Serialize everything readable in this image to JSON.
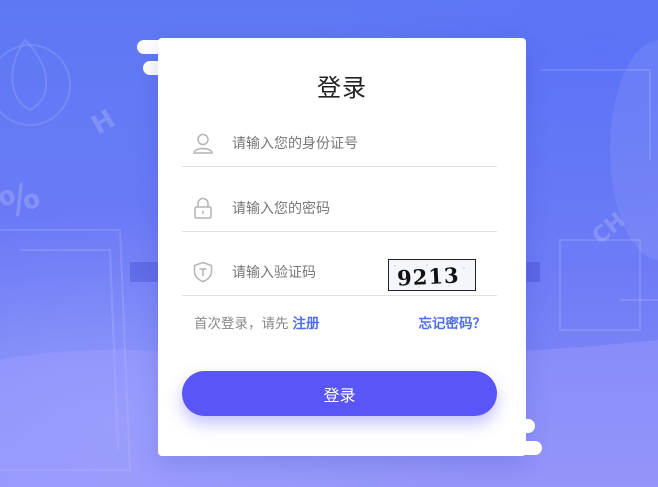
{
  "login_card": {
    "title": "登录",
    "id_field": {
      "placeholder": "请输入您的身份证号",
      "value": ""
    },
    "password_field": {
      "placeholder": "请输入您的密码",
      "value": ""
    },
    "captcha_field": {
      "placeholder": "请输入验证码",
      "value": ""
    },
    "captcha_image_text": "9213",
    "first_login_text": "首次登录，请先",
    "register_link": "注册",
    "forgot_password_link": "忘记密码？",
    "login_button": "登录"
  },
  "colors": {
    "background": "#6f7cf7",
    "accent": "#5a55f6",
    "link": "#4f6df0"
  },
  "icons": [
    "user-icon",
    "lock-icon",
    "shield-icon"
  ]
}
